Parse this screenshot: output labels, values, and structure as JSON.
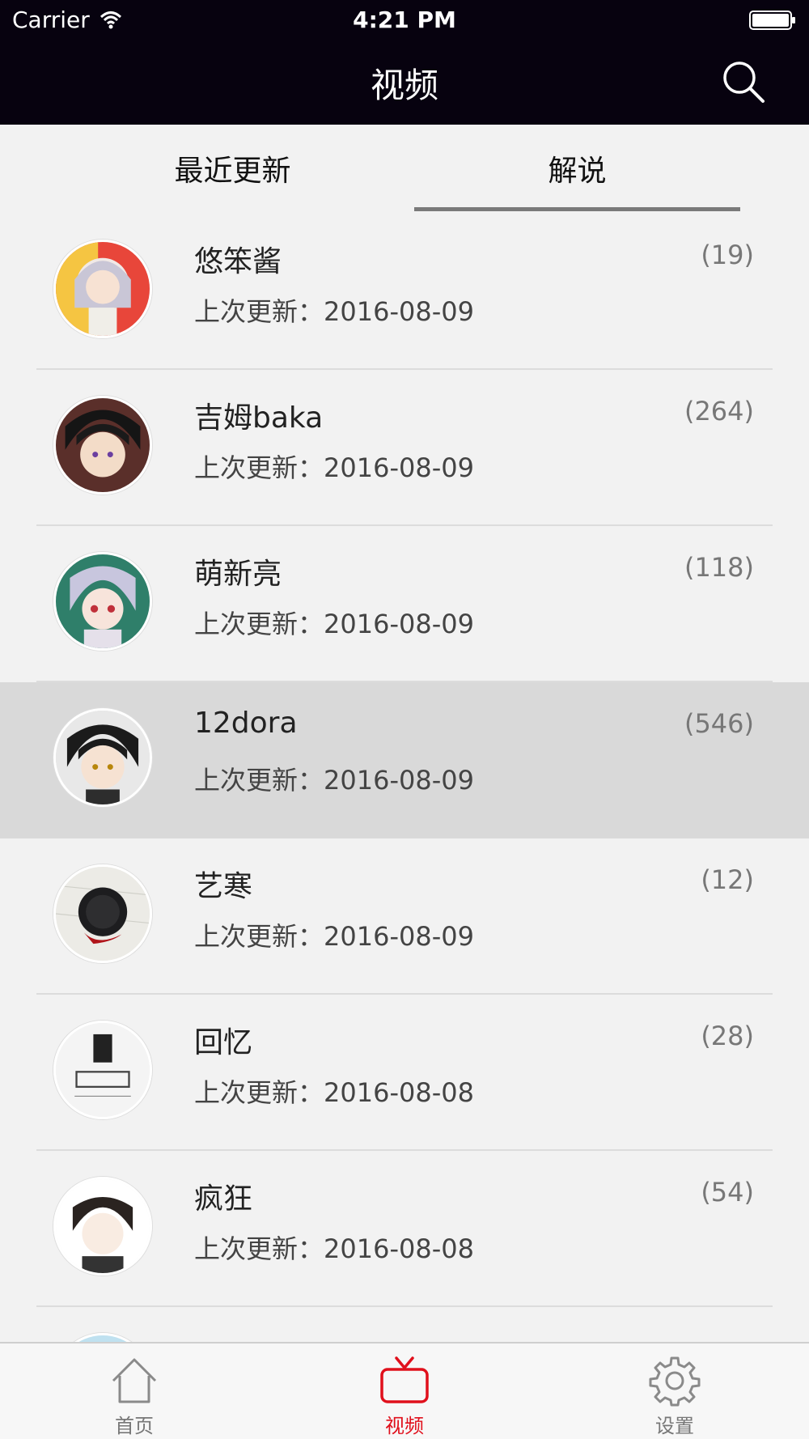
{
  "status_bar": {
    "carrier": "Carrier",
    "time": "4:21 PM"
  },
  "nav": {
    "title": "视频"
  },
  "tabs": [
    {
      "label": "最近更新",
      "active": false
    },
    {
      "label": "解说",
      "active": true
    }
  ],
  "list": [
    {
      "name": "悠笨酱",
      "count": "(19)",
      "update": "上次更新：2016-08-09",
      "highlighted": false
    },
    {
      "name": "吉姆baka",
      "count": "(264)",
      "update": "上次更新：2016-08-09",
      "highlighted": false
    },
    {
      "name": "萌新亮",
      "count": "(118)",
      "update": "上次更新：2016-08-09",
      "highlighted": false
    },
    {
      "name": "12dora",
      "count": "(546)",
      "update": "上次更新：2016-08-09",
      "highlighted": true
    },
    {
      "name": "艺寒",
      "count": "(12)",
      "update": "上次更新：2016-08-09",
      "highlighted": false
    },
    {
      "name": "回忆",
      "count": "(28)",
      "update": "上次更新：2016-08-08",
      "highlighted": false
    },
    {
      "name": "疯狂",
      "count": "(54)",
      "update": "上次更新：2016-08-08",
      "highlighted": false
    }
  ],
  "tabbar": [
    {
      "label": "首页",
      "icon": "home-icon",
      "active": false
    },
    {
      "label": "视频",
      "icon": "tv-icon",
      "active": true
    },
    {
      "label": "设置",
      "icon": "gear-icon",
      "active": false
    }
  ],
  "colors": {
    "nav_bg": "#07020f",
    "accent": "#e0101c",
    "highlight_row": "#d9d9d9"
  }
}
